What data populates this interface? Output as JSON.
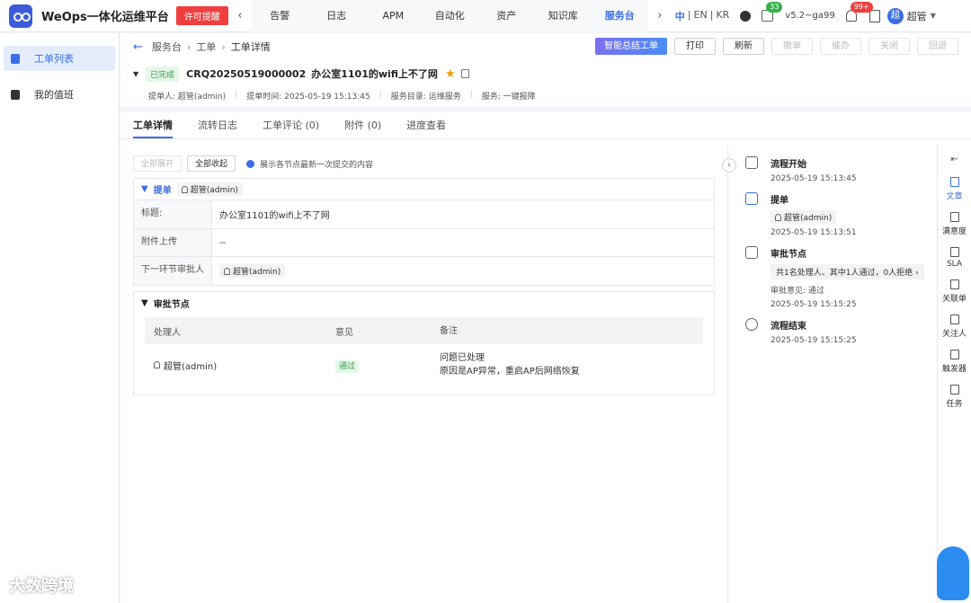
{
  "app": {
    "brand": "WeOps一体化运维平台",
    "license_label": "许可提醒",
    "version": "v5.2~ga99",
    "user": "超管",
    "avatar_text": "超",
    "badge_tasks": "33",
    "badge_notify": "99+"
  },
  "nav": {
    "items": [
      "告警",
      "日志",
      "APM",
      "自动化",
      "资产",
      "知识库",
      "服务台"
    ],
    "active_index": 6,
    "lang": [
      "中",
      "EN",
      "KR"
    ]
  },
  "sidebar": {
    "items": [
      {
        "label": "工单列表"
      },
      {
        "label": "我的值班"
      }
    ]
  },
  "header": {
    "breadcrumb": [
      "服务台",
      "工单",
      "工单详情"
    ],
    "actions": {
      "ai": "智能总结工单",
      "print": "打印",
      "refresh": "刷新",
      "withdraw": "撤单",
      "urge": "催办",
      "close": "关闭",
      "rollback": "回退"
    },
    "status": "已完成",
    "ticket_no": "CRQ20250519000002",
    "title": "办公室1101的wifi上不了网",
    "meta": {
      "creator_label": "提单人:",
      "creator": "超管(admin)",
      "time_label": "提单时间:",
      "time": "2025-05-19 15:13:45",
      "catalog_label": "服务目录:",
      "catalog": "运维服务",
      "service_label": "服务:",
      "service": "一键报障"
    }
  },
  "tabs": [
    "工单详情",
    "流转日志",
    "工单评论 (0)",
    "附件 (0)",
    "进度查看"
  ],
  "toolbar": {
    "expand_all": "全部展开",
    "collapse_all": "全部收起",
    "hint": "展示各节点最新一次提交的内容"
  },
  "submit_card": {
    "title": "提单",
    "user": "超管(admin)",
    "rows": [
      {
        "label": "标题:",
        "value": "办公室1101的wifi上不了网"
      },
      {
        "label": "附件上传",
        "value": "--"
      },
      {
        "label": "下一环节审批人",
        "value": "超管(admin)"
      }
    ]
  },
  "approval_card": {
    "title": "审批节点",
    "columns": [
      "处理人",
      "意见",
      "备注"
    ],
    "row": {
      "handler": "超管(admin)",
      "opinion": "通过",
      "note_line1": "问题已处理",
      "note_line2": "原因是AP异常，重启AP后网络恢复"
    }
  },
  "timeline": {
    "start": {
      "title": "流程开始",
      "time": "2025-05-19 15:13:45"
    },
    "submit": {
      "title": "提单",
      "user": "超管(admin)",
      "time": "2025-05-19 15:13:51"
    },
    "approval": {
      "title": "审批节点",
      "summary": "共1名处理人、其中1人通过，0人拒绝",
      "note": "审批意见: 通过",
      "time": "2025-05-19 15:15:25"
    },
    "end": {
      "title": "流程结束",
      "time": "2025-05-19 15:15:25"
    }
  },
  "rail": {
    "items": [
      "文章",
      "满意度",
      "SLA",
      "关联单",
      "关注人",
      "触发器",
      "任务"
    ]
  },
  "watermark": "大数跨境"
}
